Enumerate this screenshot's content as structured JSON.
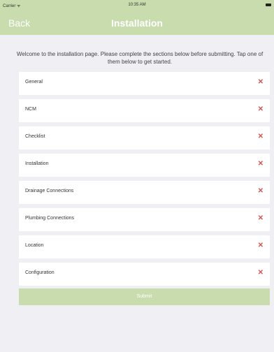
{
  "statusbar": {
    "carrier": "Carrier ᯤ",
    "time": "10:35 AM"
  },
  "navbar": {
    "back_label": "Back",
    "title": "Installation"
  },
  "intro": "Welcome to the installation page. Please complete the sections below before submitting. Tap one of them below to get started.",
  "sections": [
    {
      "label": "General",
      "status_icon": "✕"
    },
    {
      "label": "NCM",
      "status_icon": "✕"
    },
    {
      "label": "Checklist",
      "status_icon": "✕"
    },
    {
      "label": "Installation",
      "status_icon": "✕"
    },
    {
      "label": "Drainage Connections",
      "status_icon": "✕"
    },
    {
      "label": "Plumbing Connections",
      "status_icon": "✕"
    },
    {
      "label": "Location",
      "status_icon": "✕"
    },
    {
      "label": "Configuration",
      "status_icon": "✕"
    }
  ],
  "submit_label": "Submit",
  "colors": {
    "accent": "#c9dcad",
    "incomplete": "#d9534f",
    "background": "#efeff4"
  }
}
